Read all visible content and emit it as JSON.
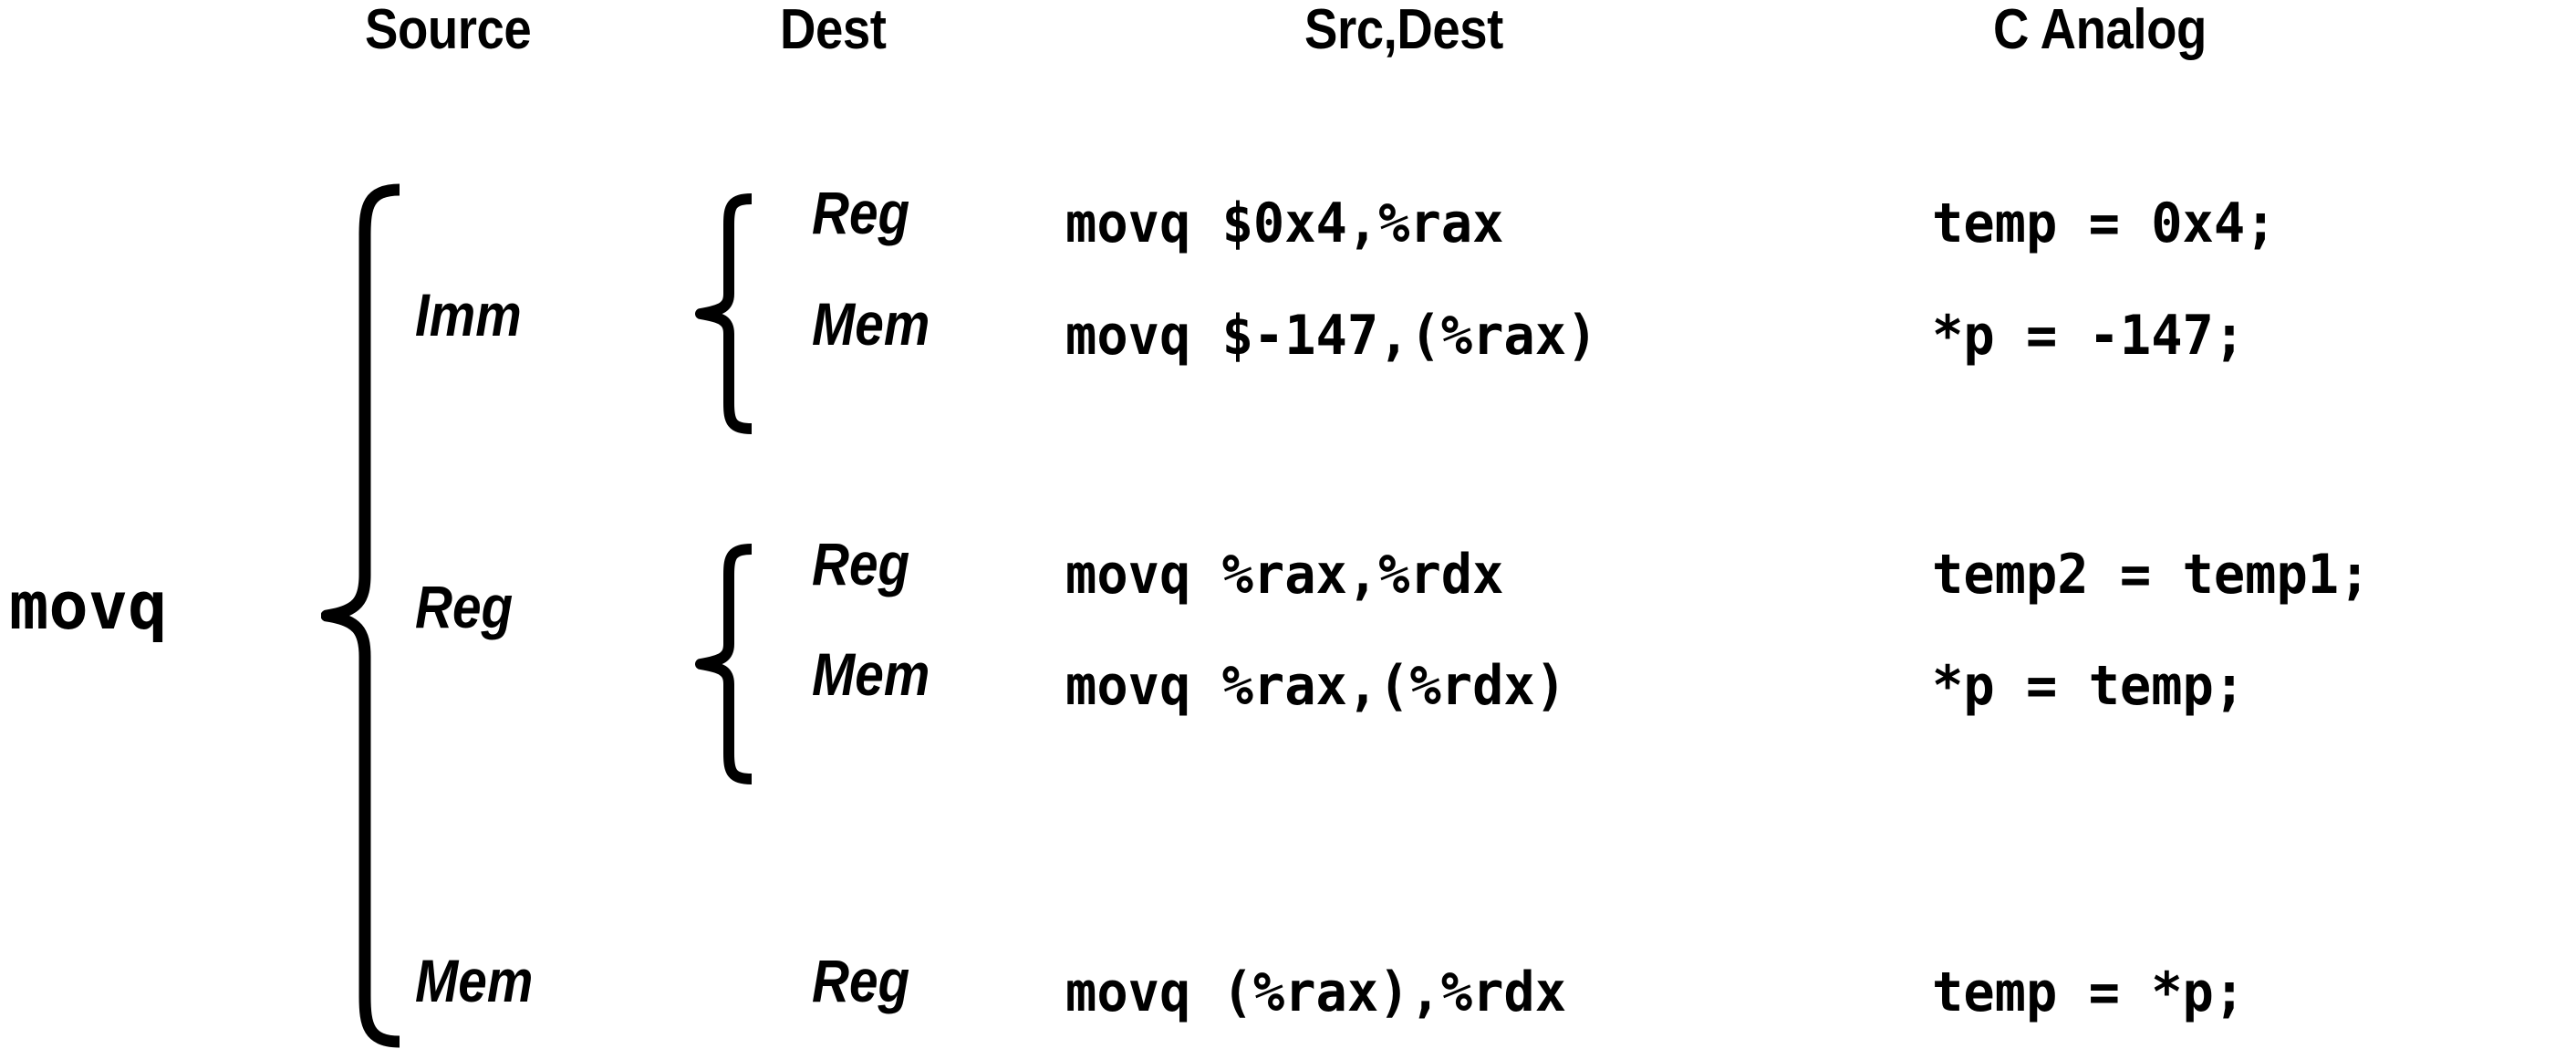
{
  "instruction": "movq",
  "headers": {
    "source": "Source",
    "dest": "Dest",
    "src_dest": "Src,Dest",
    "c_analog": "C Analog"
  },
  "source_classes": [
    {
      "label": "Imm"
    },
    {
      "label": "Reg"
    },
    {
      "label": "Mem"
    }
  ],
  "rows": [
    {
      "source": "Imm",
      "dest": "Reg",
      "src_dest": "movq $0x4,%rax",
      "c_analog": "temp = 0x4;"
    },
    {
      "source": "Imm",
      "dest": "Mem",
      "src_dest": "movq $-147,(%rax)",
      "c_analog": "*p = -147;"
    },
    {
      "source": "Reg",
      "dest": "Reg",
      "src_dest": "movq %rax,%rdx",
      "c_analog": "temp2 = temp1;"
    },
    {
      "source": "Reg",
      "dest": "Mem",
      "src_dest": "movq %rax,(%rdx)",
      "c_analog": "*p = temp;"
    },
    {
      "source": "Mem",
      "dest": "Reg",
      "src_dest": "movq (%rax),%rdx",
      "c_analog": "temp = *p;"
    }
  ],
  "colors": {
    "foreground": "#000000",
    "background": "#ffffff"
  }
}
